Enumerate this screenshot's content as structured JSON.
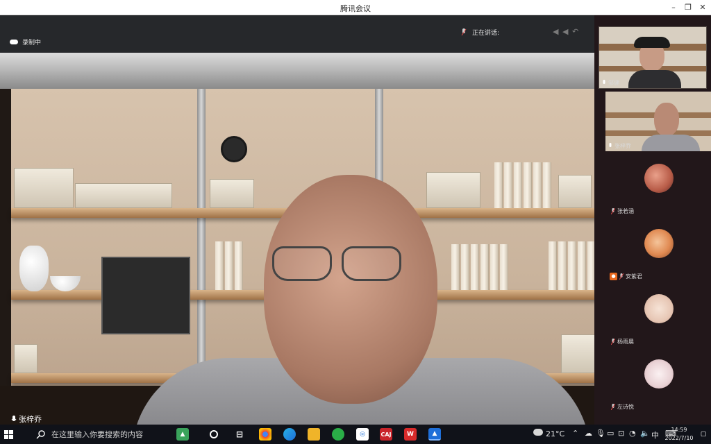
{
  "window": {
    "title": "腾讯会议",
    "minimize": "–",
    "restore": "❐",
    "close": "✕"
  },
  "toolbar": {
    "recording_label": "录制中",
    "speaking_label": "正在讲话:"
  },
  "main": {
    "speaker_name": "张梓乔"
  },
  "self_view": {
    "name": "邹健"
  },
  "participants": [
    {
      "name": "张梓乔",
      "type": "camera",
      "mic": "on"
    },
    {
      "name": "张若涵",
      "type": "avatar",
      "mic": "muted",
      "avatar_color": "#b85c48"
    },
    {
      "name": "安紫君",
      "type": "avatar",
      "mic": "muted",
      "avatar_color": "#e08a52",
      "badge": "user-icon"
    },
    {
      "name": "杨雨晨",
      "type": "avatar",
      "mic": "muted",
      "avatar_color": "#e7c7b5"
    },
    {
      "name": "左诗悦",
      "type": "avatar",
      "mic": "muted",
      "avatar_color": "#e9d2d5"
    }
  ],
  "taskbar": {
    "search_placeholder": "在这里输入你要搜索的内容",
    "weather": "21°C",
    "ime": "中",
    "time": "14:59",
    "date": "2022/7/10",
    "cnki_label": "CAJ"
  },
  "colors": {
    "accent": "#1e6fd9",
    "mute_red": "#e14b4b"
  }
}
